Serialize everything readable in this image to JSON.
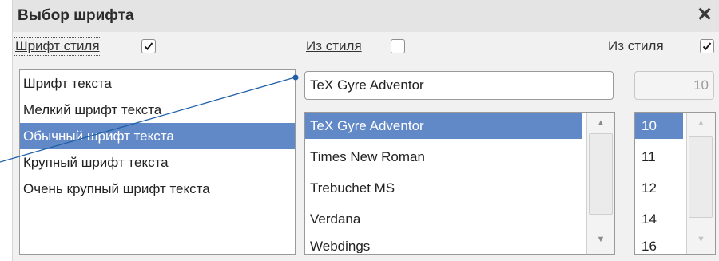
{
  "dialog": {
    "title": "Выбор шрифта",
    "close_glyph": "✕"
  },
  "style_font": {
    "label": "Шрифт стиля",
    "checked": true,
    "items": [
      "Шрифт текста",
      "Мелкий шрифт текста",
      "Обычный шрифт текста",
      "Крупный шрифт текста",
      "Очень крупный шрифт текста"
    ],
    "selected_index": 2
  },
  "font_family": {
    "label": "Из стиля",
    "checked": false,
    "value": "TeX Gyre Adventor",
    "items": [
      "TeX Gyre Adventor",
      "Times New Roman",
      "Trebuchet MS",
      "Verdana",
      "Webdings"
    ],
    "selected_index": 0
  },
  "font_size": {
    "label": "Из стиля",
    "checked": true,
    "value": "10",
    "items": [
      "10",
      "11",
      "12",
      "14",
      "16"
    ],
    "selected_index": 0
  },
  "colors": {
    "selection": "#6189c7",
    "connector": "#1f5fa8"
  }
}
